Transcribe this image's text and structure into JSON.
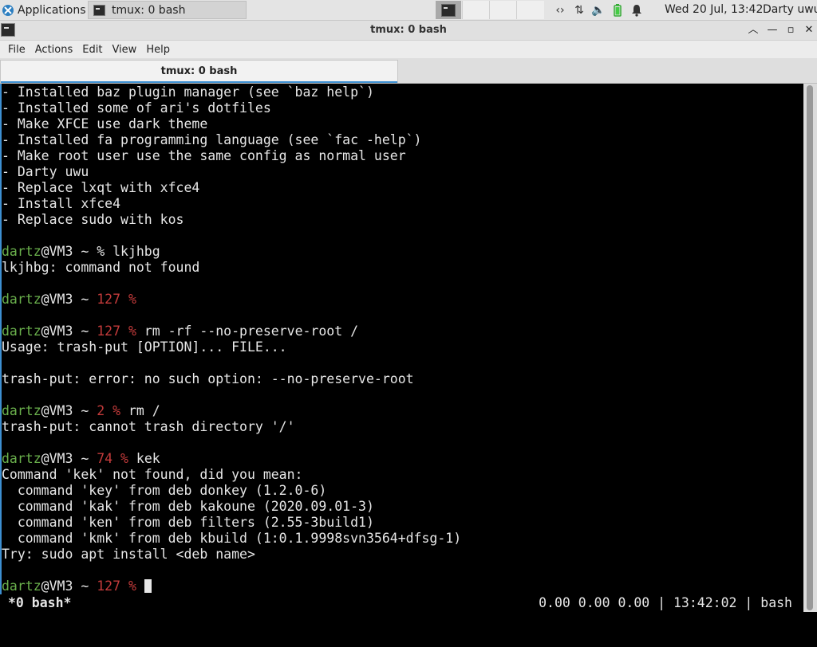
{
  "panel": {
    "applications_label": "Applications",
    "task_label": "tmux: 0 bash",
    "clock": "Wed 20 Jul, 13:42",
    "user": "Darty uwu"
  },
  "window": {
    "title": "tmux: 0 bash",
    "menus": [
      "File",
      "Actions",
      "Edit",
      "View",
      "Help"
    ],
    "tab_label": "tmux: 0 bash"
  },
  "terminal": {
    "lines": [
      [
        {
          "t": "- Installed baz plugin manager (see `baz help`)"
        }
      ],
      [
        {
          "t": "- Installed some of ari's dotfiles"
        }
      ],
      [
        {
          "t": "- Make XFCE use dark theme"
        }
      ],
      [
        {
          "t": "- Installed fa programming language (see `fac -help`)"
        }
      ],
      [
        {
          "t": "- Make root user use the same config as normal user"
        }
      ],
      [
        {
          "t": "- Darty uwu"
        }
      ],
      [
        {
          "t": "- Replace lxqt with xfce4"
        }
      ],
      [
        {
          "t": "- Install xfce4"
        }
      ],
      [
        {
          "t": "- Replace sudo with kos"
        }
      ],
      [
        {
          "t": ""
        }
      ],
      [
        {
          "t": "dartz",
          "c": "u"
        },
        {
          "t": "@VM3 ~ % lkjhbg"
        }
      ],
      [
        {
          "t": "lkjhbg: command not found"
        }
      ],
      [
        {
          "t": ""
        }
      ],
      [
        {
          "t": "dartz",
          "c": "u"
        },
        {
          "t": "@VM3 ~ "
        },
        {
          "t": "127 %",
          "c": "r"
        }
      ],
      [
        {
          "t": ""
        }
      ],
      [
        {
          "t": "dartz",
          "c": "u"
        },
        {
          "t": "@VM3 ~ "
        },
        {
          "t": "127 %",
          "c": "r"
        },
        {
          "t": " rm -rf --no-preserve-root /"
        }
      ],
      [
        {
          "t": "Usage: trash-put [OPTION]... FILE..."
        }
      ],
      [
        {
          "t": ""
        }
      ],
      [
        {
          "t": "trash-put: error: no such option: --no-preserve-root"
        }
      ],
      [
        {
          "t": ""
        }
      ],
      [
        {
          "t": "dartz",
          "c": "u"
        },
        {
          "t": "@VM3 ~ "
        },
        {
          "t": "2 %",
          "c": "r"
        },
        {
          "t": " rm /"
        }
      ],
      [
        {
          "t": "trash-put: cannot trash directory '/'"
        }
      ],
      [
        {
          "t": ""
        }
      ],
      [
        {
          "t": "dartz",
          "c": "u"
        },
        {
          "t": "@VM3 ~ "
        },
        {
          "t": "74 %",
          "c": "r"
        },
        {
          "t": " kek"
        }
      ],
      [
        {
          "t": "Command 'kek' not found, did you mean:"
        }
      ],
      [
        {
          "t": "  command 'key' from deb donkey (1.2.0-6)"
        }
      ],
      [
        {
          "t": "  command 'kak' from deb kakoune (2020.09.01-3)"
        }
      ],
      [
        {
          "t": "  command 'ken' from deb filters (2.55-3build1)"
        }
      ],
      [
        {
          "t": "  command 'kmk' from deb kbuild (1:0.1.9998svn3564+dfsg-1)"
        }
      ],
      [
        {
          "t": "Try: sudo apt install <deb name>"
        }
      ],
      [
        {
          "t": ""
        }
      ],
      [
        {
          "t": "dartz",
          "c": "u"
        },
        {
          "t": "@VM3 ~ "
        },
        {
          "t": "127 %",
          "c": "r"
        },
        {
          "t": " "
        },
        {
          "cursor": true
        }
      ]
    ],
    "status_left": "*0 bash*",
    "status_right": "0.00 0.00 0.00 | 13:42:02 | bash"
  },
  "colors": {
    "username": "#6ab04c",
    "exit_code": "#c43b3b",
    "accent": "#3d8fd1"
  }
}
